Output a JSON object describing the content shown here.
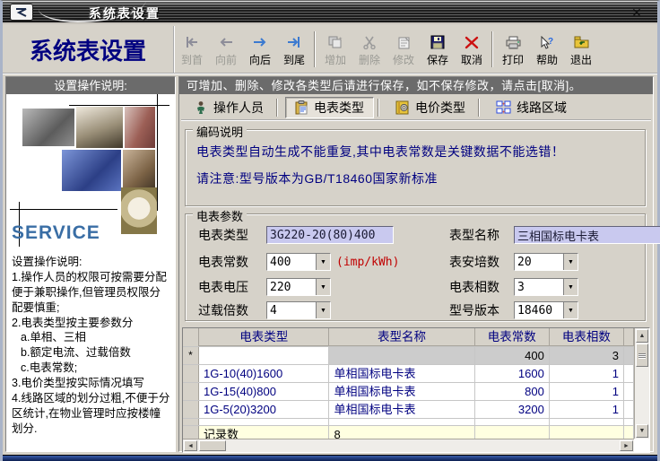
{
  "window": {
    "title": "系统表设置",
    "close_glyph": "✕"
  },
  "page_header": {
    "title": "系统表设置"
  },
  "toolbar": {
    "buttons": [
      {
        "label": "到首",
        "enabled": false
      },
      {
        "label": "向前",
        "enabled": false
      },
      {
        "label": "向后",
        "enabled": true
      },
      {
        "label": "到尾",
        "enabled": true
      },
      {
        "label": "增加",
        "enabled": false
      },
      {
        "label": "删除",
        "enabled": false
      },
      {
        "label": "修改",
        "enabled": false
      },
      {
        "label": "保存",
        "enabled": true
      },
      {
        "label": "取消",
        "enabled": true
      },
      {
        "label": "打印",
        "enabled": true
      },
      {
        "label": "帮助",
        "enabled": true
      },
      {
        "label": "退出",
        "enabled": true
      }
    ]
  },
  "sidebar": {
    "header": "设置操作说明:",
    "service_text": "SERVICE",
    "instructions": [
      "设置操作说明:",
      "1.操作人员的权限可按需要分配便于兼职操作,但管理员权限分配要慎重;",
      "2.电表类型按主要参数分",
      "a.单相、三相",
      "b.额定电流、过载倍数",
      "c.电表常数;",
      "3.电价类型按实际情况填写",
      "4.线路区域的划分过粗,不便于分区统计,在物业管理时应按楼幢划分."
    ]
  },
  "main": {
    "notice": "可增加、删除、修改各类型后请进行保存，如不保存修改，请点击[取消]。",
    "tabs": [
      {
        "label": "操作人员",
        "active": false
      },
      {
        "label": "电表类型",
        "active": true
      },
      {
        "label": "电价类型",
        "active": false
      },
      {
        "label": "线路区域",
        "active": false
      }
    ],
    "coding_group": {
      "title": "编码说明",
      "line1": "电表类型自动生成不能重复,其中电表常数是关键数据不能选错！",
      "line2": "请注意:型号版本为GB/T18460国家新标准"
    },
    "params_group": {
      "title": "电表参数",
      "fields": {
        "meter_type": {
          "label": "电表类型",
          "value": "3G220-20(80)400"
        },
        "model_name": {
          "label": "表型名称",
          "value": "三相国标电卡表"
        },
        "meter_constant": {
          "label": "电表常数",
          "value": "400",
          "unit": "(imp/kWh)"
        },
        "ampere": {
          "label": "表安培数",
          "value": "20"
        },
        "voltage": {
          "label": "电表电压",
          "value": "220"
        },
        "phases": {
          "label": "电表相数",
          "value": "3"
        },
        "overload": {
          "label": "过载倍数",
          "value": "4"
        },
        "version": {
          "label": "型号版本",
          "value": "18460"
        }
      }
    },
    "table": {
      "headers": [
        "电表类型",
        "表型名称",
        "电表常数",
        "电表相数"
      ],
      "rows": [
        {
          "selector": "*",
          "meter_type": "",
          "model_name": "",
          "constant": "400",
          "phases": "3"
        },
        {
          "selector": "",
          "meter_type": "1G-10(40)1600",
          "model_name": "单相国标电卡表",
          "constant": "1600",
          "phases": "1"
        },
        {
          "selector": "",
          "meter_type": "1G-15(40)800",
          "model_name": "单相国标电卡表",
          "constant": "800",
          "phases": "1"
        },
        {
          "selector": "",
          "meter_type": "1G-5(20)3200",
          "model_name": "单相国标电卡表",
          "constant": "3200",
          "phases": "1"
        }
      ],
      "footer": {
        "label": "记录数",
        "value": "8"
      }
    }
  },
  "colors": {
    "accent_navy": "#000080",
    "alert_red": "#c00000",
    "field_lavender": "#c9c9ef",
    "bar_gray": "#6b6b6b",
    "footer_cream": "#ffffe1",
    "face": "#d6d2c9"
  }
}
